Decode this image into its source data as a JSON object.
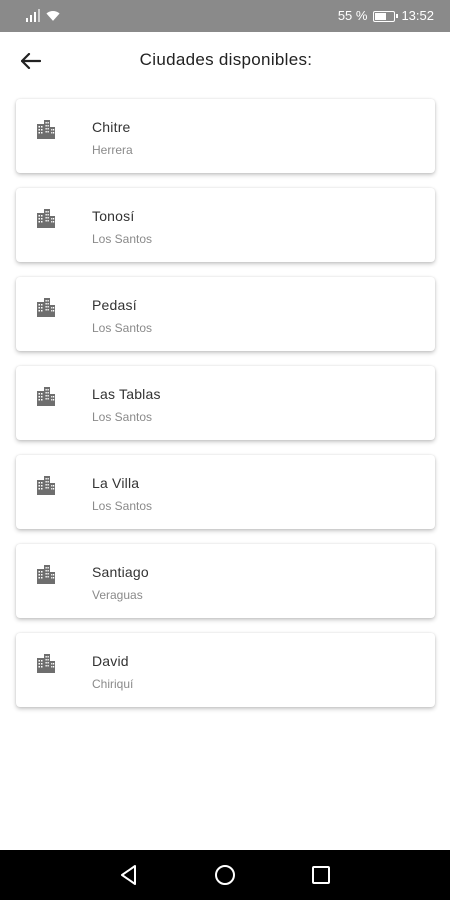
{
  "status_bar": {
    "battery_text": "55 %",
    "time": "13:52",
    "battery_level": 0.55
  },
  "header": {
    "title": "Ciudades disponibles:",
    "back_icon": "arrow-left-icon"
  },
  "cities": [
    {
      "name": "Chitre",
      "region": "Herrera",
      "icon": "city-icon"
    },
    {
      "name": "Tonosí",
      "region": "Los Santos",
      "icon": "city-icon"
    },
    {
      "name": "Pedasí",
      "region": "Los Santos",
      "icon": "city-icon"
    },
    {
      "name": "Las Tablas",
      "region": "Los Santos",
      "icon": "city-icon"
    },
    {
      "name": "La Villa",
      "region": "Los Santos",
      "icon": "city-icon"
    },
    {
      "name": "Santiago",
      "region": "Veraguas",
      "icon": "city-icon"
    },
    {
      "name": "David",
      "region": "Chiriquí",
      "icon": "city-icon"
    }
  ],
  "nav_bar": {
    "back_icon": "triangle-back-icon",
    "home_icon": "circle-home-icon",
    "recents_icon": "square-recents-icon"
  },
  "colors": {
    "status_bar_bg": "#8a8a8a",
    "icon_gray": "#6e6e6e",
    "title_text": "#222222",
    "subtitle_text": "#8a8a8a"
  }
}
